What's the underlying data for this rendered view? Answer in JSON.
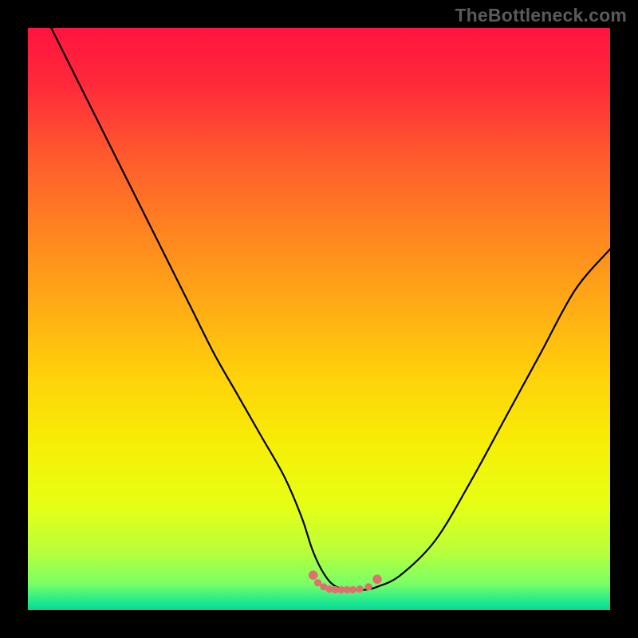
{
  "watermark": "TheBottleneck.com",
  "gradient_stops": [
    {
      "offset": 0.0,
      "color": "#ff143f"
    },
    {
      "offset": 0.1,
      "color": "#ff2a3a"
    },
    {
      "offset": 0.22,
      "color": "#ff5a2d"
    },
    {
      "offset": 0.35,
      "color": "#ff8420"
    },
    {
      "offset": 0.48,
      "color": "#ffac15"
    },
    {
      "offset": 0.6,
      "color": "#ffd20a"
    },
    {
      "offset": 0.72,
      "color": "#f6ef06"
    },
    {
      "offset": 0.82,
      "color": "#e6ff15"
    },
    {
      "offset": 0.9,
      "color": "#b8ff3a"
    },
    {
      "offset": 0.955,
      "color": "#7aff66"
    },
    {
      "offset": 0.985,
      "color": "#22e98f"
    },
    {
      "offset": 1.0,
      "color": "#06d69a"
    }
  ],
  "chart_data": {
    "type": "line",
    "title": "",
    "xlabel": "",
    "ylabel": "",
    "xlim": [
      0,
      100
    ],
    "ylim": [
      0,
      100
    ],
    "grid": false,
    "legend": false,
    "series": [
      {
        "name": "bottleneck-curve",
        "x": [
          4,
          8,
          12,
          16,
          20,
          24,
          28,
          32,
          36,
          40,
          44,
          47,
          49,
          51,
          53,
          56,
          58,
          60,
          64,
          70,
          76,
          82,
          88,
          94,
          100
        ],
        "y": [
          100,
          92,
          84,
          76,
          68,
          60,
          52,
          44,
          37,
          30,
          23,
          16,
          10,
          6,
          4,
          3.5,
          3.5,
          4,
          6,
          12,
          22,
          33,
          44,
          55,
          62
        ]
      }
    ],
    "markers": {
      "name": "flat-segment-dots",
      "color": "#e07070",
      "x": [
        49.0,
        49.8,
        50.8,
        51.8,
        52.8,
        53.8,
        54.8,
        55.8,
        57.0,
        58.5,
        60.0
      ],
      "y": [
        6.0,
        4.7,
        4.0,
        3.6,
        3.5,
        3.5,
        3.5,
        3.5,
        3.6,
        4.0,
        5.3
      ]
    }
  }
}
